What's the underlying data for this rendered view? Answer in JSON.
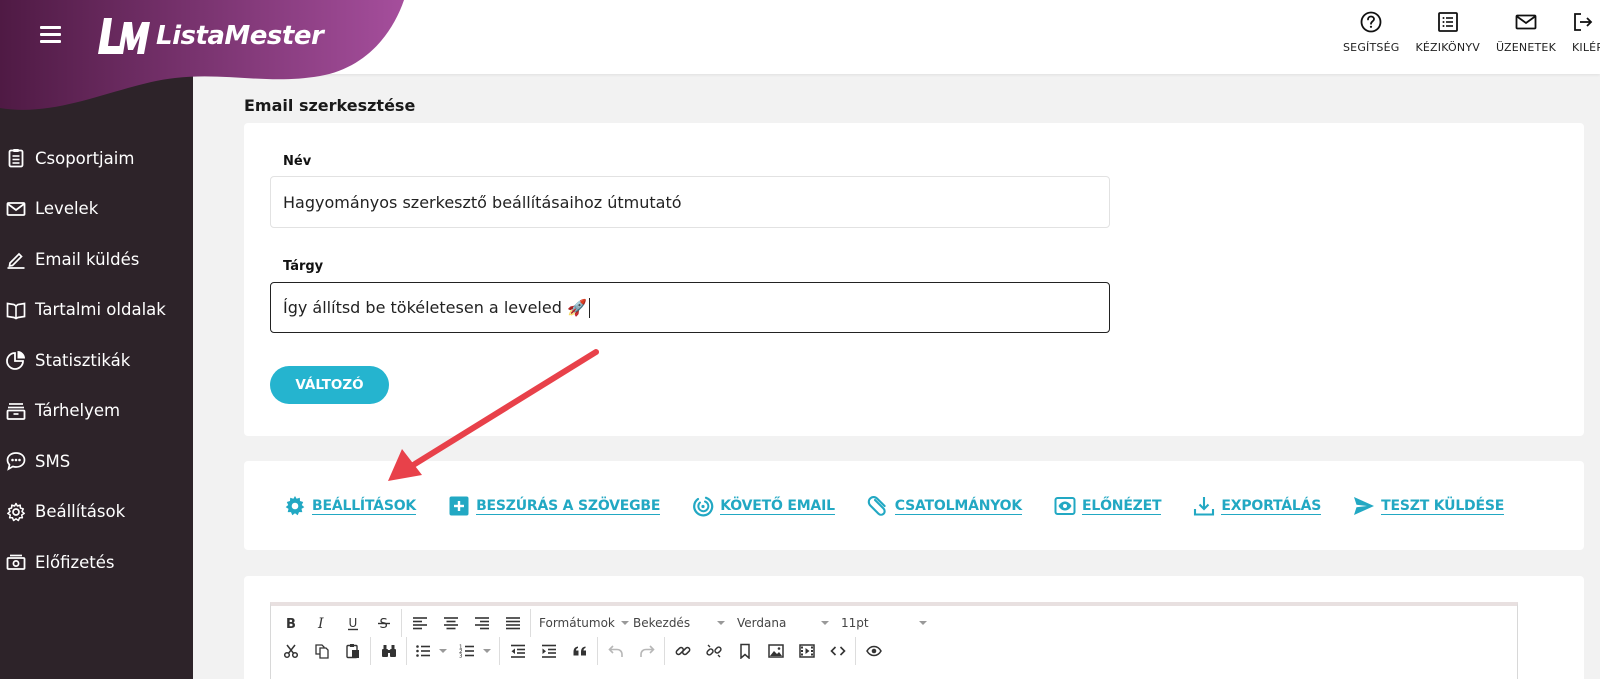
{
  "brand": {
    "name": "ListaMester",
    "accent": "#25b4cf",
    "blob_color_start": "#4f1a44",
    "blob_color_end": "#a54e9c"
  },
  "sidebar": {
    "items": [
      {
        "label": "Csoportjaim",
        "icon": "clipboard-icon"
      },
      {
        "label": "Levelek",
        "icon": "envelope-icon"
      },
      {
        "label": "Email küldés",
        "icon": "pencil-icon"
      },
      {
        "label": "Tartalmi oldalak",
        "icon": "book-icon"
      },
      {
        "label": "Statisztikák",
        "icon": "pie-chart-icon"
      },
      {
        "label": "Tárhelyem",
        "icon": "archive-icon"
      },
      {
        "label": "SMS",
        "icon": "chat-bubble-icon"
      },
      {
        "label": "Beállítások",
        "icon": "gear-icon"
      },
      {
        "label": "Előfizetés",
        "icon": "money-icon"
      }
    ]
  },
  "topbar": {
    "actions": [
      {
        "label": "SEGÍTSÉG",
        "icon": "help-circle-icon"
      },
      {
        "label": "KÉZIKÖNYV",
        "icon": "list-icon"
      },
      {
        "label": "ÜZENETEK",
        "icon": "envelope-icon"
      },
      {
        "label": "KILÉP",
        "icon": "logout-icon"
      }
    ]
  },
  "page": {
    "title": "Email szerkesztése"
  },
  "form": {
    "nev_label": "Név",
    "nev_value": "Hagyományos szerkesztő beállításaihoz útmutató",
    "targy_label": "Tárgy",
    "targy_value": "Így állítsd be tökéletesen a leveled 🚀",
    "variable_button": "VÁLTOZÓ"
  },
  "email_toolbar": {
    "items": [
      {
        "label": "BEÁLLÍTÁSOK",
        "icon": "gear-icon"
      },
      {
        "label": "BESZÚRÁS A SZÖVEGBE",
        "icon": "plus-box-icon"
      },
      {
        "label": "KÖVETŐ EMAIL",
        "icon": "follow-up-icon"
      },
      {
        "label": "CSATOLMÁNYOK",
        "icon": "paperclip-icon"
      },
      {
        "label": "ELŐNÉZET",
        "icon": "eye-icon"
      },
      {
        "label": "EXPORTÁLÁS",
        "icon": "download-icon"
      },
      {
        "label": "TESZT KÜLDÉSE",
        "icon": "send-icon"
      }
    ]
  },
  "editor": {
    "formats_label": "Formátumok",
    "paragraph_label": "Bekezdés",
    "font_label": "Verdana",
    "size_label": "11pt"
  }
}
